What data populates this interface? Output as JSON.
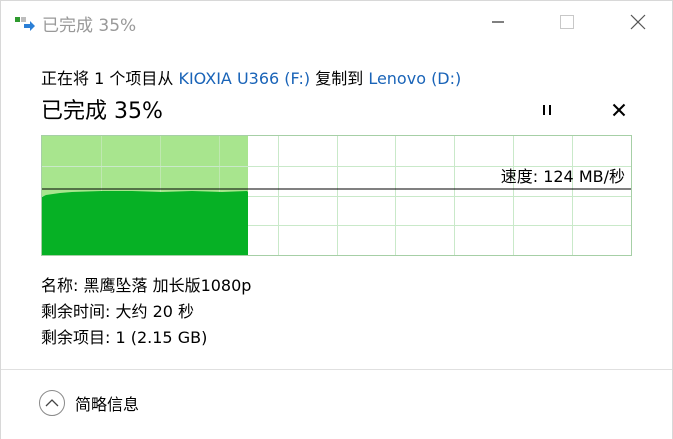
{
  "window": {
    "title": "已完成 35%"
  },
  "header": {
    "prefix": "正在将 1 个项目从 ",
    "source": "KIOXIA U366 (F:)",
    "middle": " 复制到 ",
    "destination": "Lenovo (D:)"
  },
  "progress": {
    "title": "已完成 35%",
    "fraction": 0.35,
    "speed_label": "速度: 124 MB/秒"
  },
  "details": {
    "name": "名称: 黑鹰坠落 加长版1080p",
    "time_remaining": "剩余时间: 大约 20 秒",
    "items_remaining": "剩余项目: 1 (2.15 GB)"
  },
  "footer": {
    "toggle_label": "简略信息"
  },
  "icons": {
    "title": "copy-icon",
    "minimize": "minimize-icon",
    "maximize": "maximize-icon",
    "close": "close-icon",
    "pause": "pause-icon",
    "stop": "stop-icon",
    "collapse": "chevron-up-icon"
  },
  "colors": {
    "progress_fill": "#a8e58e",
    "speed_fill": "#06b125",
    "grid": "#c9e9c9",
    "link": "#1a64b8"
  }
}
